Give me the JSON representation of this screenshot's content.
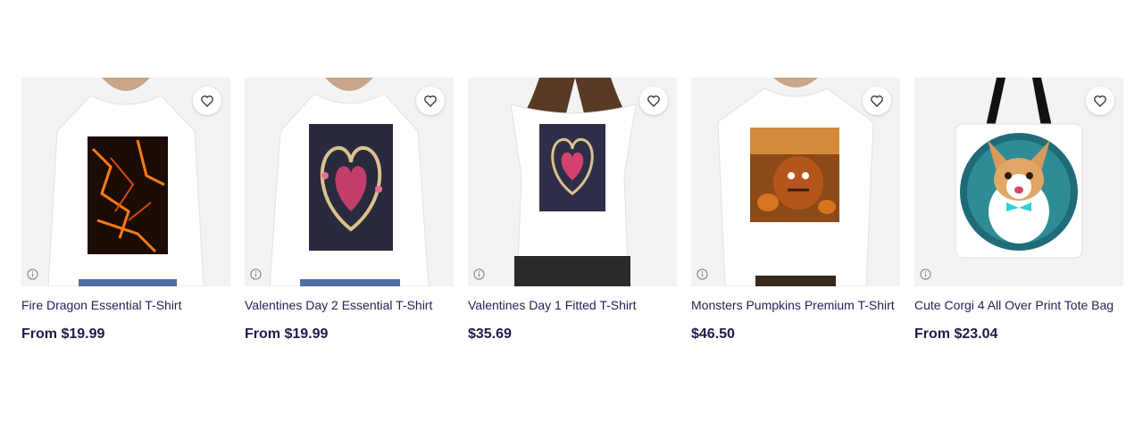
{
  "products": [
    {
      "title": "Fire Dragon Essential T-Shirt",
      "price": "From $19.99",
      "image": "fire-dragon-tshirt"
    },
    {
      "title": "Valentines Day 2 Essential T-Shirt",
      "price": "From $19.99",
      "image": "valentines-day-2-tshirt"
    },
    {
      "title": "Valentines Day 1 Fitted T-Shirt",
      "price": "$35.69",
      "image": "valentines-day-1-fitted-tshirt"
    },
    {
      "title": "Monsters Pumpkins Premium T-Shirt",
      "price": "$46.50",
      "image": "monsters-pumpkins-tshirt"
    },
    {
      "title": "Cute Corgi 4 All Over Print Tote Bag",
      "price": "From $23.04",
      "image": "cute-corgi-tote-bag"
    }
  ],
  "icons": {
    "favorite": "heart-icon",
    "info": "info-icon"
  }
}
